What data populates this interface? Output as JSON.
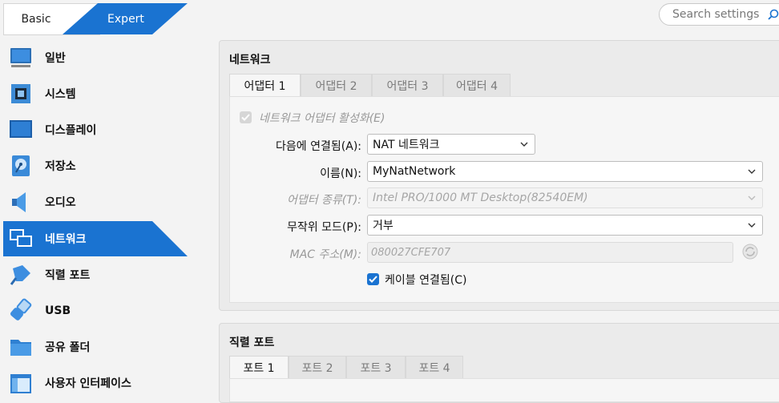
{
  "modes": {
    "basic": "Basic",
    "expert": "Expert"
  },
  "search": {
    "placeholder": "Search settings"
  },
  "sidebar": {
    "items": [
      {
        "label": "일반",
        "icon": "monitor-icon"
      },
      {
        "label": "시스템",
        "icon": "chip-icon"
      },
      {
        "label": "디스플레이",
        "icon": "display-icon"
      },
      {
        "label": "저장소",
        "icon": "disk-icon"
      },
      {
        "label": "오디오",
        "icon": "speaker-icon"
      },
      {
        "label": "네트워크",
        "icon": "network-icon",
        "active": true
      },
      {
        "label": "직렬 포트",
        "icon": "serial-port-icon"
      },
      {
        "label": "USB",
        "icon": "usb-icon"
      },
      {
        "label": "공유 폴더",
        "icon": "folder-icon"
      },
      {
        "label": "사용자 인터페이스",
        "icon": "ui-window-icon"
      }
    ]
  },
  "network": {
    "title": "네트워크",
    "tabs": [
      "어댑터 1",
      "어댑터 2",
      "어댑터 3",
      "어댑터 4"
    ],
    "enable_label": "네트워크 어댑터 활성화(E)",
    "attached_label": "다음에 연결됨(A):",
    "attached_value": "NAT 네트워크",
    "name_label": "이름(N):",
    "name_value": "MyNatNetwork",
    "adapter_type_label": "어댑터 종류(T):",
    "adapter_type_value": "Intel PRO/1000 MT Desktop(82540EM)",
    "promisc_label": "무작위 모드(P):",
    "promisc_value": "거부",
    "mac_label": "MAC 주소(M):",
    "mac_value": "080027CFE707",
    "cable_label": "케이블 연결됨(C)"
  },
  "serial": {
    "title": "직렬 포트",
    "tabs": [
      "포트 1",
      "포트 2",
      "포트 3",
      "포트 4"
    ]
  },
  "colors": {
    "accent": "#1a73d1"
  }
}
